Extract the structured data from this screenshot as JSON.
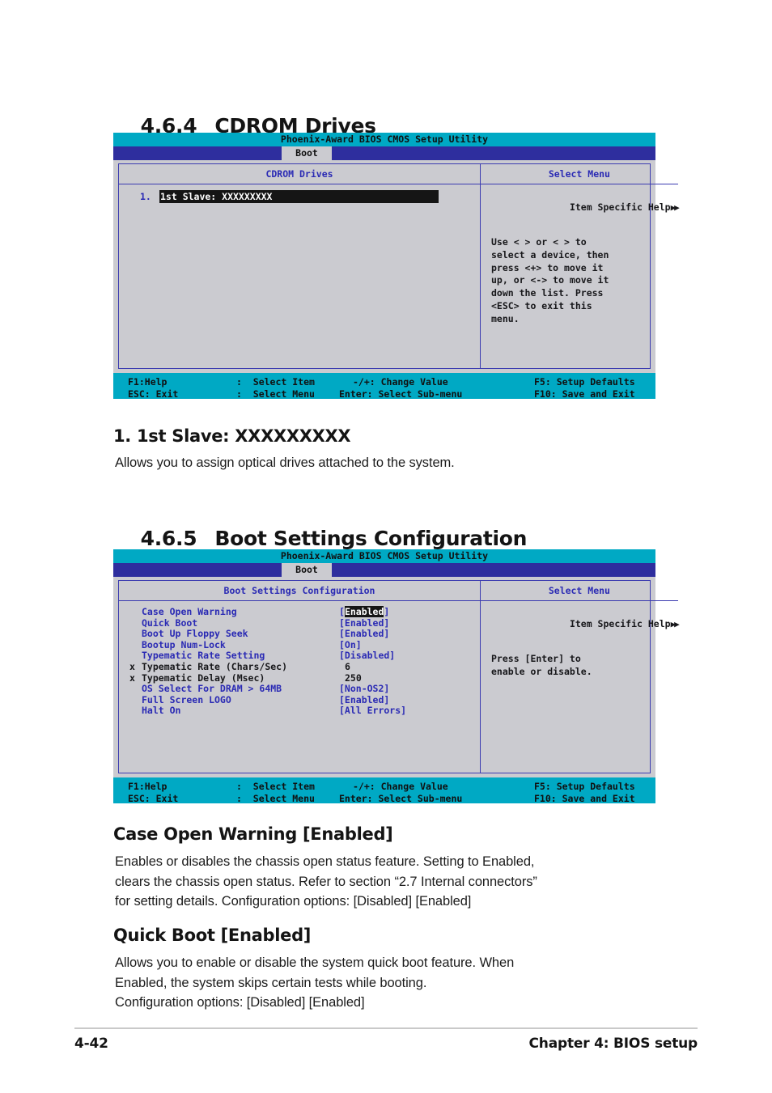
{
  "document": {
    "sections": [
      {
        "number": "4.6.4",
        "title": "CDROM Drives"
      },
      {
        "number": "4.6.5",
        "title": "Boot Settings Configuration"
      }
    ],
    "footer": {
      "page_number": "4-42",
      "chapter": "Chapter 4: BIOS setup"
    }
  },
  "bios_common": {
    "title": "Phoenix-Award BIOS CMOS Setup Utility",
    "tab": "Boot",
    "right_panel_header": "Select Menu",
    "help_heading": "Item Specific Help",
    "help_arrows": "▶▶",
    "legend": {
      "f1": "F1:Help",
      "esc": "ESC: Exit",
      "select_item": ":  Select Item",
      "select_menu": ":  Select Menu",
      "change_value": "-/+: Change Value",
      "select_submenu": "Enter: Select Sub-menu",
      "setup_defaults": "F5: Setup Defaults",
      "save_exit": "F10: Save and Exit"
    }
  },
  "screen_cdrom": {
    "left_panel_header": "CDROM Drives",
    "drives": [
      {
        "index": "1.",
        "label": "1st Slave: XXXXXXXXX",
        "selected": true
      }
    ],
    "help_body": "Use < > or < > to\nselect a device, then\npress <+> to move it\nup, or <-> to move it\ndown the list. Press\n<ESC> to exit this\nmenu."
  },
  "screen_boot_settings": {
    "left_panel_header": "Boot Settings Configuration",
    "items": [
      {
        "marker": "",
        "label": "Case Open Warning",
        "value": "[Enabled]",
        "highlighted": true,
        "dim": false,
        "bracketed": true
      },
      {
        "marker": "",
        "label": "Quick Boot",
        "value": "[Enabled]",
        "highlighted": false,
        "dim": false,
        "bracketed": true
      },
      {
        "marker": "",
        "label": "Boot Up Floppy Seek",
        "value": "[Enabled]",
        "highlighted": false,
        "dim": false,
        "bracketed": true
      },
      {
        "marker": "",
        "label": "Bootup Num-Lock",
        "value": "[On]",
        "highlighted": false,
        "dim": false,
        "bracketed": true
      },
      {
        "marker": "",
        "label": "Typematic Rate Setting",
        "value": "[Disabled]",
        "highlighted": false,
        "dim": false,
        "bracketed": true
      },
      {
        "marker": "x",
        "label": "Typematic Rate (Chars/Sec)",
        "value": "6",
        "highlighted": false,
        "dim": true,
        "bracketed": false
      },
      {
        "marker": "x",
        "label": "Typematic Delay (Msec)",
        "value": "250",
        "highlighted": false,
        "dim": true,
        "bracketed": false
      },
      {
        "marker": "",
        "label": "OS Select For DRAM > 64MB",
        "value": "[Non-OS2]",
        "highlighted": false,
        "dim": false,
        "bracketed": true
      },
      {
        "marker": "",
        "label": "Full Screen LOGO",
        "value": "[Enabled]",
        "highlighted": false,
        "dim": false,
        "bracketed": true
      },
      {
        "marker": "",
        "label": "Halt On",
        "value": "[All Errors]",
        "highlighted": false,
        "dim": false,
        "bracketed": true
      }
    ],
    "help_body": "Press [Enter] to\nenable or disable."
  },
  "descriptions": [
    {
      "heading": "1. 1st Slave: XXXXXXXXX",
      "body": "Allows you to assign optical drives attached to the system."
    },
    {
      "heading": "Case Open Warning [Enabled]",
      "body": "Enables or disables the chassis open status feature. Setting to Enabled,\nclears the chassis open status. Refer to section “2.7 Internal connectors”\nfor setting details. Configuration options: [Disabled] [Enabled]"
    },
    {
      "heading": "Quick Boot [Enabled]",
      "body": "Allows you to enable or disable the system quick boot feature. When\nEnabled, the system skips certain tests while booting.\nConfiguration options: [Disabled] [Enabled]"
    }
  ]
}
